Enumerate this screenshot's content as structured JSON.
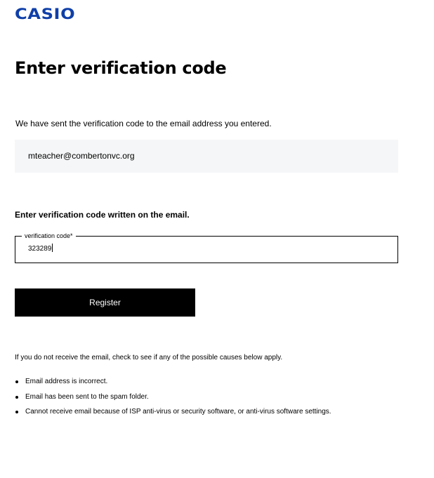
{
  "brand": {
    "logo_text": "CASIO",
    "color": "#0f3fa8"
  },
  "page": {
    "title": "Enter verification code",
    "sent_note": "We have sent the verification code to the email address you entered.",
    "email": "mteacher@combertonvc.org",
    "instruction": "Enter verification code written on the email."
  },
  "form": {
    "code_label": "verification code*",
    "code_value": "323289",
    "register_label": "Register"
  },
  "help": {
    "intro": "If you do not receive the email, check to see if any of the possible causes below apply.",
    "causes": [
      "Email address is incorrect.",
      "Email has been sent to the spam folder.",
      "Cannot receive email because of ISP anti-virus or security software, or anti-virus software settings."
    ]
  }
}
